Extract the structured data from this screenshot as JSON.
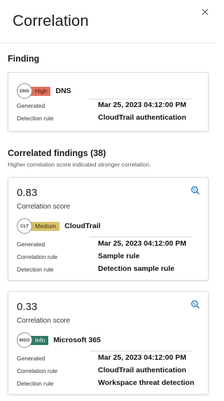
{
  "panel": {
    "title": "Correlation"
  },
  "finding": {
    "section_title": "Finding",
    "entity": {
      "badge": "DNS",
      "severity": "High",
      "name": "DNS"
    },
    "rows": [
      {
        "label": "Generated",
        "value": "Mar 25, 2023 04:12:00 PM"
      },
      {
        "label": "Detection rule",
        "value": "CloudTrail authentication"
      }
    ]
  },
  "correlated": {
    "section_title": "Correlated findings (38)",
    "subtitle": "Higher correlation score indicated stronger correlation.",
    "items": [
      {
        "score": "0.83",
        "score_label": "Correlation score",
        "entity": {
          "badge": "CLT",
          "severity": "Medium",
          "name": "CloudTrail"
        },
        "rows": [
          {
            "label": "Generated",
            "value": "Mar 25, 2023 04:12:00 PM"
          },
          {
            "label": "Correlation rule",
            "value": "Sample rule"
          },
          {
            "label": "Detection rule",
            "value": "Detection sample rule"
          }
        ]
      },
      {
        "score": "0.33",
        "score_label": "Correlation score",
        "entity": {
          "badge": "MSO",
          "severity": "Info",
          "name": "Microsoft 365"
        },
        "rows": [
          {
            "label": "Generated",
            "value": "Mar 25, 2023 04:12:00 PM"
          },
          {
            "label": "Correlation rule",
            "value": "CloudTrail authentication"
          },
          {
            "label": "Detection rule",
            "value": "Workspace threat detection"
          }
        ]
      }
    ]
  },
  "colors": {
    "severity_high": "#e0715f",
    "severity_medium": "#d7c26a",
    "severity_info": "#2f7a66",
    "accent": "#1a73b5"
  },
  "icons": {
    "close": "close-icon",
    "investigate": "investigate-icon"
  }
}
